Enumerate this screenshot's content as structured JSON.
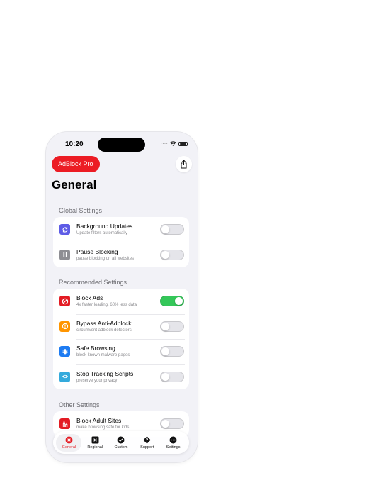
{
  "status_bar": {
    "time": "10:20"
  },
  "header": {
    "brand": "AdBlock Pro",
    "title": "General"
  },
  "sections": [
    {
      "header": "Global Settings",
      "rows": [
        {
          "title": "Background Updates",
          "subtitle": "Update filters automatically",
          "icon": "refresh-icon",
          "icon_color": "#5e5ce6",
          "on": false
        },
        {
          "title": "Pause Blocking",
          "subtitle": "pause blocking on all websites",
          "icon": "pause-icon",
          "icon_color": "#8e8e93",
          "on": false
        }
      ]
    },
    {
      "header": "Recommended Settings",
      "rows": [
        {
          "title": "Block Ads",
          "subtitle": "4x faster loading, 60% less data",
          "icon": "block-icon",
          "icon_color": "#e31b23",
          "on": true
        },
        {
          "title": "Bypass Anti-Adblock",
          "subtitle": "circumvent adblock detectors",
          "icon": "warning-icon",
          "icon_color": "#ff9500",
          "on": false
        },
        {
          "title": "Safe Browsing",
          "subtitle": "block known malware pages",
          "icon": "bug-icon",
          "icon_color": "#1e7cf2",
          "on": false
        },
        {
          "title": "Stop Tracking Scripts",
          "subtitle": "preserve your privacy",
          "icon": "eye-icon",
          "icon_color": "#34aadc",
          "on": false
        }
      ]
    },
    {
      "header": "Other Settings",
      "rows": [
        {
          "title": "Block Adult Sites",
          "subtitle": "make browsing safe for kids",
          "icon": "family-icon",
          "icon_color": "#e31b23",
          "on": false
        }
      ]
    }
  ],
  "tabbar": {
    "items": [
      {
        "label": "General",
        "icon": "x-circle-icon",
        "active": true
      },
      {
        "label": "Regional",
        "icon": "x-square-icon",
        "active": false
      },
      {
        "label": "Custom",
        "icon": "checkmark-circle-icon",
        "active": false
      },
      {
        "label": "Support",
        "icon": "question-diamond-icon",
        "active": false
      },
      {
        "label": "Settings",
        "icon": "ellipsis-circle-icon",
        "active": false
      }
    ]
  },
  "colors": {
    "brand": "#ec1c24",
    "toggle_on": "#34c759",
    "background": "#f2f2f7"
  }
}
